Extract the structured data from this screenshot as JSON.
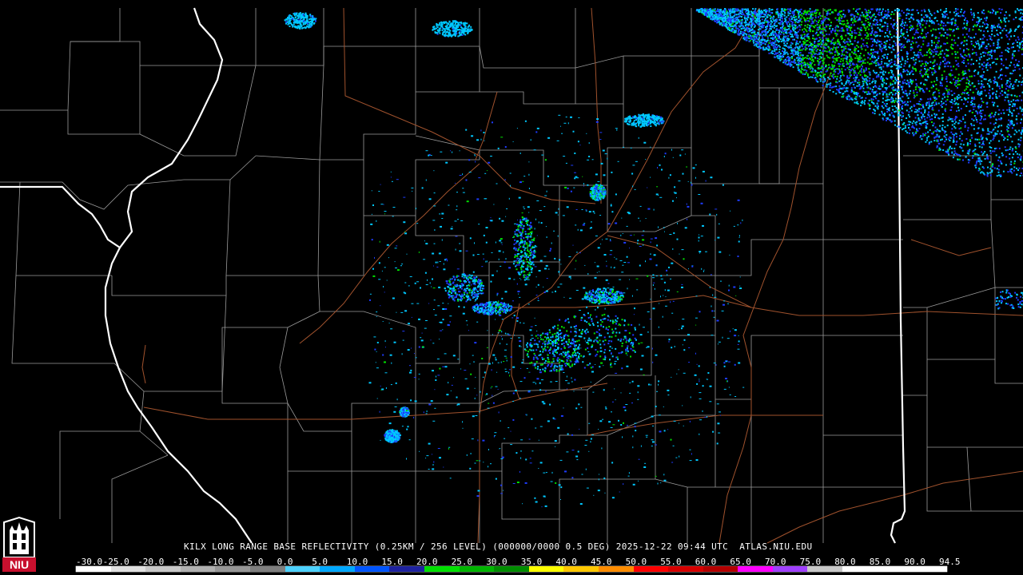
{
  "caption": "KILX LONG RANGE BASE REFLECTIVITY (0.25KM / 256 LEVEL) (000000/0000 0.5 DEG) 2025-12-22 09:44 UTC  ATLAS.NIU.EDU",
  "logo_text": "NIU",
  "colors": {
    "background": "#000000",
    "county_border": "#9a9a9a",
    "state_border": "#ffffff",
    "highway": "#a0522d",
    "light_precip": "#00c8ff",
    "moderate_precip": "#1e3cff",
    "heavy_precip": "#00e000",
    "logo_red": "#c8102e"
  },
  "colorbar": {
    "ticks": [
      "-30.0",
      "-25.0",
      "-20.0",
      "-15.0",
      "-10.0",
      "-5.0",
      "0.0",
      "5.0",
      "10.0",
      "15.0",
      "20.0",
      "25.0",
      "30.0",
      "35.0",
      "40.0",
      "45.0",
      "50.0",
      "55.0",
      "60.0",
      "65.0",
      "70.0",
      "75.0",
      "80.0",
      "85.0",
      "90.0",
      "94.5"
    ],
    "colors": [
      "#ffffff",
      "#e0e0e0",
      "#c8c8c8",
      "#b0b0b0",
      "#969696",
      "#7f7f7f",
      "#4dd2ff",
      "#00a8ff",
      "#0055ff",
      "#1e22a0",
      "#00e000",
      "#00b400",
      "#008c00",
      "#ffff00",
      "#ffc800",
      "#ff8c00",
      "#ff0000",
      "#d60000",
      "#b40000",
      "#ff00ff",
      "#a040ff",
      "#c8c8c8",
      "#ffffff",
      "#ffffff",
      "#ffffff"
    ]
  }
}
